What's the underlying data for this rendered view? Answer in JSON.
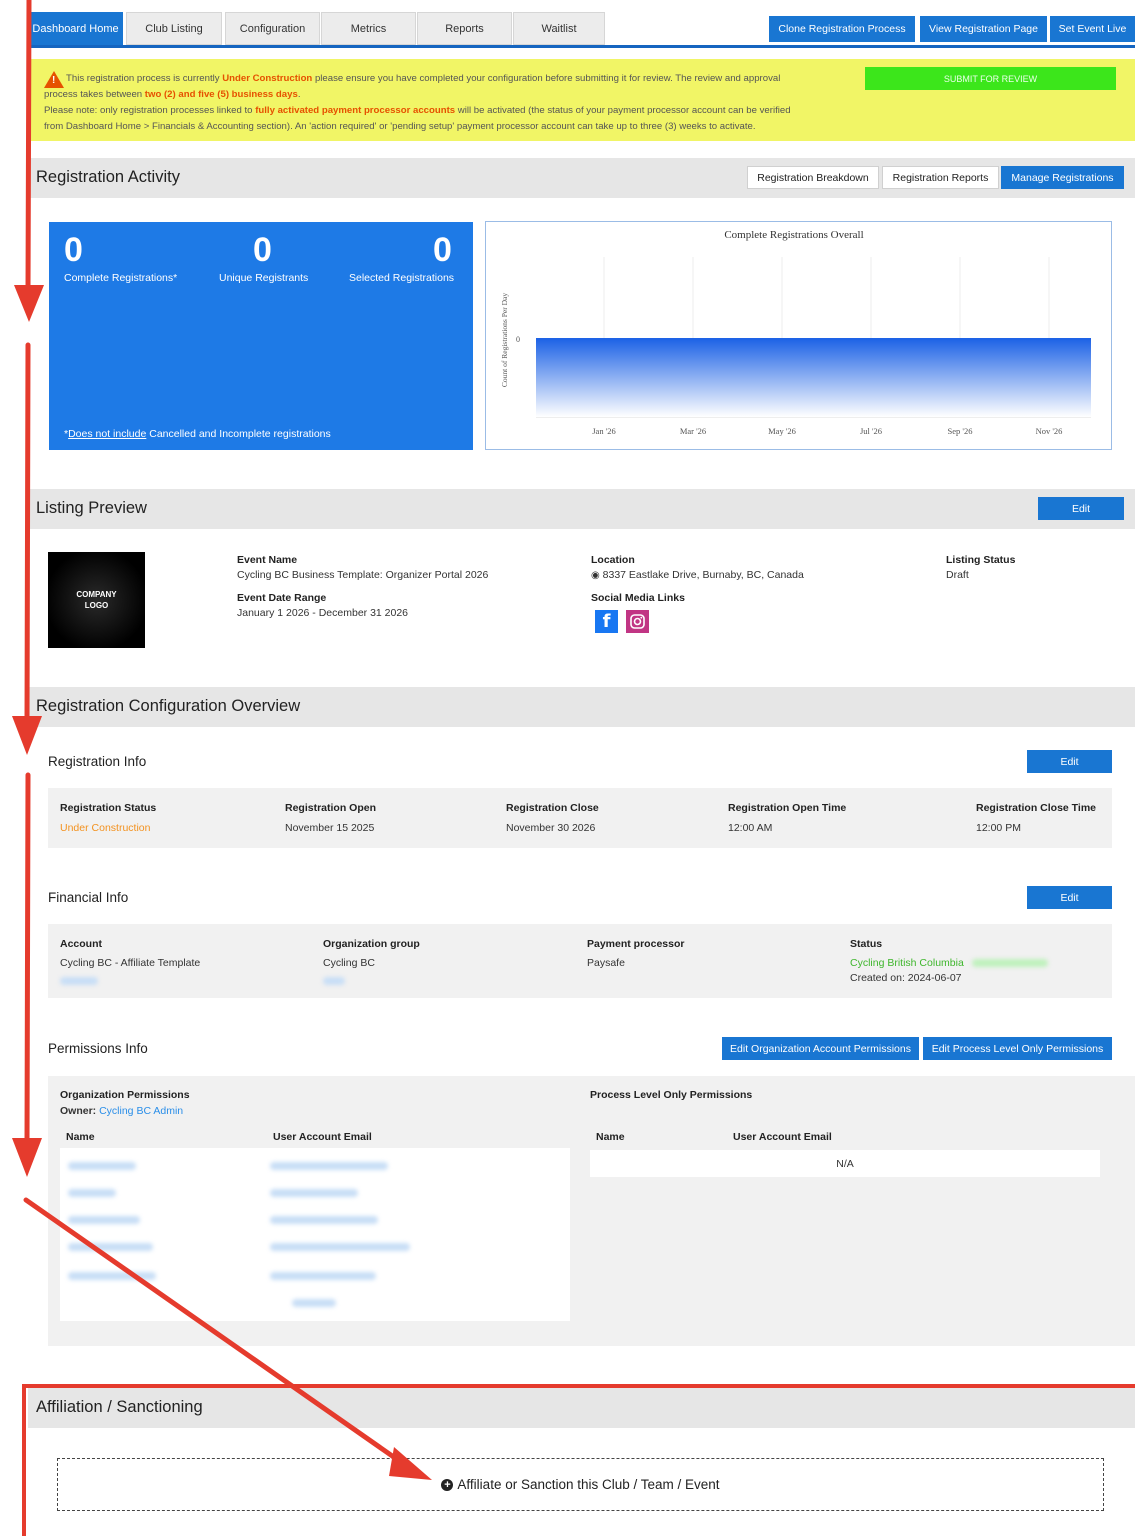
{
  "nav": {
    "tabs": [
      "Dashboard Home",
      "Club Listing",
      "Configuration",
      "Metrics",
      "Reports",
      "Waitlist"
    ],
    "active_tab": "Dashboard Home",
    "actions": [
      "Clone Registration Process",
      "View Registration Page",
      "Set Event Live"
    ]
  },
  "banner": {
    "line1_pre": "This registration process is currently ",
    "status": "Under Construction",
    "line1_post": " please ensure you have completed your configuration before submitting it for review. The review and approval",
    "line2_pre": "process takes between ",
    "duration": "two (2) and five (5) business days",
    "line2_post": ".",
    "line3_pre": "Please note: only registration processes linked to ",
    "processor_note": "fully activated payment processor accounts",
    "line3_post": " will be activated (the status of your payment processor account can be verified",
    "line4": "from Dashboard Home > Financials & Accounting section). An 'action required' or 'pending setup' payment processor account can take up to three (3) weeks to activate.",
    "submit_label": "SUBMIT FOR REVIEW"
  },
  "activity": {
    "title": "Registration Activity",
    "buttons": [
      "Registration Breakdown",
      "Registration Reports",
      "Manage Registrations"
    ],
    "stats": [
      {
        "value": "0",
        "label": "Complete Registrations*"
      },
      {
        "value": "0",
        "label": "Unique Registrants"
      },
      {
        "value": "0",
        "label": "Selected Registrations"
      }
    ],
    "note_underlined": "Does not include",
    "note_rest": " Cancelled and Incomplete registrations",
    "note_prefix": "*"
  },
  "chart_data": {
    "type": "area",
    "title": "Complete Registrations Overall",
    "ylabel": "Count of Registrations Per Day",
    "xlabel": "",
    "x_ticks": [
      "Jan '26",
      "Mar '26",
      "May '26",
      "Jul '26",
      "Sep '26",
      "Nov '26"
    ],
    "y_ticks": [
      "0"
    ],
    "series": [
      {
        "values": [
          0,
          0,
          0,
          0,
          0,
          0
        ]
      }
    ],
    "colors": {
      "fill_top": "#1e63e6",
      "fill_bottom": "#ffffff",
      "line": "#1e63e6"
    }
  },
  "listing": {
    "title": "Listing Preview",
    "edit_label": "Edit",
    "logo_text": "COMPANY LOGO",
    "event_name_label": "Event Name",
    "event_name": "Cycling BC Business Template: Organizer Portal 2026",
    "date_range_label": "Event Date Range",
    "date_range": "January 1 2026 - December 31 2026",
    "location_label": "Location",
    "location": "8337 Eastlake Drive, Burnaby, BC, Canada",
    "social_label": "Social Media Links",
    "status_label": "Listing Status",
    "status": "Draft"
  },
  "config": {
    "title": "Registration Configuration Overview",
    "registration": {
      "title": "Registration Info",
      "edit_label": "Edit",
      "fields": [
        {
          "label": "Registration Status",
          "value": "Under Construction"
        },
        {
          "label": "Registration Open",
          "value": "November 15 2025"
        },
        {
          "label": "Registration Close",
          "value": "November 30 2026"
        },
        {
          "label": "Registration Open Time",
          "value": "12:00 AM"
        },
        {
          "label": "Registration Close Time",
          "value": "12:00 PM"
        }
      ]
    },
    "financial": {
      "title": "Financial Info",
      "edit_label": "Edit",
      "fields": [
        {
          "label": "Account",
          "value": "Cycling BC - Affiliate Template"
        },
        {
          "label": "Organization group",
          "value": "Cycling BC"
        },
        {
          "label": "Payment processor",
          "value": "Paysafe"
        },
        {
          "label": "Status",
          "value": "Cycling British Columbia"
        }
      ],
      "created": "Created on: 2024-06-07"
    },
    "permissions": {
      "title": "Permissions Info",
      "buttons": [
        "Edit Organization Account Permissions",
        "Edit Process Level Only Permissions"
      ],
      "org_title": "Organization Permissions",
      "owner_label": "Owner:",
      "owner": "Cycling BC Admin",
      "col_name": "Name",
      "col_email": "User Account Email",
      "process_title": "Process Level Only Permissions",
      "process_empty": "N/A"
    }
  },
  "affiliation": {
    "title": "Affiliation / Sanctioning",
    "action": "Affiliate or Sanction this Club / Team / Event"
  },
  "colors": {
    "accent": "#1976d2",
    "warning_bg": "#f1f566",
    "submit": "#3ce61b",
    "annotation": "#e53b2d"
  }
}
